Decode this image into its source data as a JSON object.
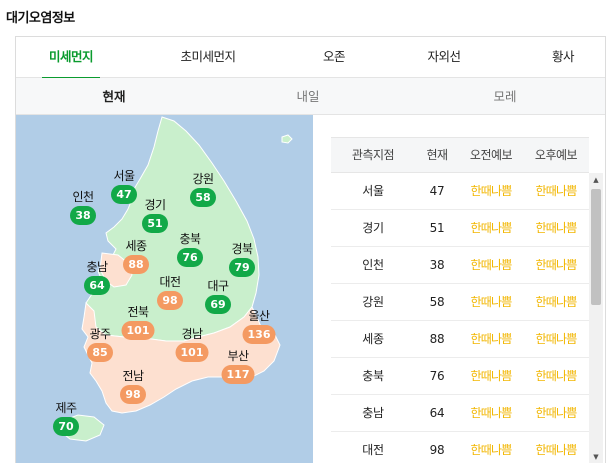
{
  "page_title": "대기오염정보",
  "tabs": [
    {
      "label": "미세먼지",
      "active": true
    },
    {
      "label": "초미세먼지",
      "active": false
    },
    {
      "label": "오존",
      "active": false
    },
    {
      "label": "자외선",
      "active": false
    },
    {
      "label": "황사",
      "active": false
    }
  ],
  "subtabs": [
    {
      "label": "현재",
      "active": true
    },
    {
      "label": "내일",
      "active": false
    },
    {
      "label": "모레",
      "active": false
    }
  ],
  "map": {
    "colors": {
      "sea": "#b1cde7",
      "good_land": "#c9efcc",
      "bad_land": "#fde0d0",
      "good_badge": "#12a948",
      "bad_badge": "#f49a62"
    },
    "regions": [
      {
        "name": "서울",
        "value": "47",
        "status": "good"
      },
      {
        "name": "인천",
        "value": "38",
        "status": "good"
      },
      {
        "name": "경기",
        "value": "51",
        "status": "good"
      },
      {
        "name": "강원",
        "value": "58",
        "status": "good"
      },
      {
        "name": "세종",
        "value": "88",
        "status": "bad"
      },
      {
        "name": "충북",
        "value": "76",
        "status": "good"
      },
      {
        "name": "경북",
        "value": "79",
        "status": "good"
      },
      {
        "name": "충남",
        "value": "64",
        "status": "good"
      },
      {
        "name": "대전",
        "value": "98",
        "status": "bad"
      },
      {
        "name": "대구",
        "value": "69",
        "status": "good"
      },
      {
        "name": "전북",
        "value": "101",
        "status": "bad"
      },
      {
        "name": "울산",
        "value": "136",
        "status": "bad"
      },
      {
        "name": "광주",
        "value": "85",
        "status": "bad"
      },
      {
        "name": "경남",
        "value": "101",
        "status": "bad"
      },
      {
        "name": "부산",
        "value": "117",
        "status": "bad"
      },
      {
        "name": "전남",
        "value": "98",
        "status": "bad"
      },
      {
        "name": "제주",
        "value": "70",
        "status": "good"
      }
    ]
  },
  "table": {
    "headers": [
      "관측지점",
      "현재",
      "오전예보",
      "오후예보"
    ],
    "forecast_color": "#f2b600",
    "rows": [
      {
        "station": "서울",
        "current": "47",
        "am": "한때나쁨",
        "pm": "한때나쁨"
      },
      {
        "station": "경기",
        "current": "51",
        "am": "한때나쁨",
        "pm": "한때나쁨"
      },
      {
        "station": "인천",
        "current": "38",
        "am": "한때나쁨",
        "pm": "한때나쁨"
      },
      {
        "station": "강원",
        "current": "58",
        "am": "한때나쁨",
        "pm": "한때나쁨"
      },
      {
        "station": "세종",
        "current": "88",
        "am": "한때나쁨",
        "pm": "한때나쁨"
      },
      {
        "station": "충북",
        "current": "76",
        "am": "한때나쁨",
        "pm": "한때나쁨"
      },
      {
        "station": "충남",
        "current": "64",
        "am": "한때나쁨",
        "pm": "한때나쁨"
      },
      {
        "station": "대전",
        "current": "98",
        "am": "한때나쁨",
        "pm": "한때나쁨"
      }
    ]
  },
  "scrollbar": {
    "up_icon": "triangle-up-icon",
    "down_icon": "triangle-down-icon"
  }
}
